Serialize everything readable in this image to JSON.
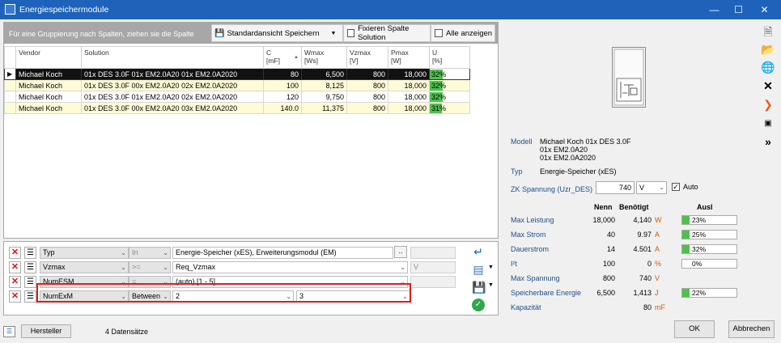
{
  "window": {
    "title": "Energiespeichermodule"
  },
  "groupbar": {
    "hint": "Für eine Gruppierung nach Spalten, ziehen sie die Spalte",
    "save_view": "Standardansicht Speichern",
    "fix_column": "Fixieren Spalte Solution",
    "show_all": "Alle anzeigen"
  },
  "grid": {
    "headers": [
      {
        "label": "Vendor",
        "unit": ""
      },
      {
        "label": "Solution",
        "unit": ""
      },
      {
        "label": "C",
        "unit": "[mF]"
      },
      {
        "label": "Wmax",
        "unit": "[Ws]"
      },
      {
        "label": "Vzmax",
        "unit": "[V]"
      },
      {
        "label": "Pmax",
        "unit": "[W]"
      },
      {
        "label": "U",
        "unit": "[%]"
      }
    ],
    "rows": [
      {
        "vendor": "Michael Koch",
        "solution": "01x DES 3.0F  01x EM2.0A20  01x EM2.0A2020",
        "c": "80",
        "wmax": "6,500",
        "vzmax": "800",
        "pmax": "18,000",
        "u": "32%",
        "u_value": 32
      },
      {
        "vendor": "Michael Koch",
        "solution": "01x DES 3.0F  00x EM2.0A20  02x EM2.0A2020",
        "c": "100",
        "wmax": "8,125",
        "vzmax": "800",
        "pmax": "18,000",
        "u": "32%",
        "u_value": 32
      },
      {
        "vendor": "Michael Koch",
        "solution": "01x DES 3.0F  01x EM2.0A20  02x EM2.0A2020",
        "c": "120",
        "wmax": "9,750",
        "vzmax": "800",
        "pmax": "18,000",
        "u": "32%",
        "u_value": 32
      },
      {
        "vendor": "Michael Koch",
        "solution": "01x DES 3.0F  00x EM2.0A20  03x EM2.0A2020",
        "c": "140.0",
        "wmax": "11,375",
        "vzmax": "800",
        "pmax": "18,000",
        "u": "31%",
        "u_value": 31
      }
    ]
  },
  "filters": [
    {
      "field": "Typ",
      "op": "In",
      "value": "Energie-Speicher (xES), Erweiterungsmodul (EM)",
      "value2": ""
    },
    {
      "field": "Vzmax",
      "op": ">=",
      "value": "Req_Vzmax",
      "value2": "V"
    },
    {
      "field": "NumESM",
      "op": "=",
      "value": "(auto)  [1 - 5]",
      "value2": ""
    },
    {
      "field": "NumExM",
      "op": "Between",
      "value": "2",
      "value2": "3"
    }
  ],
  "filter_browse": "..",
  "status": {
    "hersteller_btn": "Hersteller",
    "records": "4  Datensätze"
  },
  "details": {
    "modell_label": "Modell",
    "modell_lines": [
      "Michael Koch 01x DES 3.0F",
      "01x EM2.0A20",
      "01x EM2.0A2020"
    ],
    "typ_label": "Typ",
    "typ_value": "Energie-Speicher (xES)",
    "zk_label": "ZK Spannung (Uzr_DES)",
    "zk_value": "740",
    "zk_unit": "V",
    "auto_label": "Auto",
    "col_nenn": "Nenn",
    "col_benoetigt": "Benötigt",
    "col_ausl": "Ausl",
    "rows": [
      {
        "label": "Max Leistung",
        "nenn": "18,000",
        "ben": "4,140",
        "unit": "W",
        "ausl": "23%",
        "ausl_value": 23
      },
      {
        "label": "Max Strom",
        "nenn": "40",
        "ben": "9.97",
        "unit": "A",
        "ausl": "25%",
        "ausl_value": 25
      },
      {
        "label": "Dauerstrom",
        "nenn": "14",
        "ben": "4.501",
        "unit": "A",
        "ausl": "32%",
        "ausl_value": 32
      },
      {
        "label": "I²t",
        "nenn": "100",
        "ben": "0",
        "unit": "%",
        "ausl": "0%",
        "ausl_value": 0
      },
      {
        "label": "Max Spannung",
        "nenn": "800",
        "ben": "740",
        "unit": "V",
        "ausl": "",
        "ausl_value": null
      },
      {
        "label": "Speicherbare Energie",
        "nenn": "6,500",
        "ben": "1,413",
        "unit": "J",
        "ausl": "22%",
        "ausl_value": 22
      },
      {
        "label": "Kapazität",
        "nenn": "",
        "ben": "80",
        "unit": "mF",
        "ausl": "",
        "ausl_value": null
      }
    ]
  },
  "buttons": {
    "ok": "OK",
    "cancel": "Abbrechen"
  },
  "colors": {
    "titlebar": "#1e63b9",
    "highlight": "#e11b1b",
    "bar_green": "#4cc24c",
    "row_alt": "#fffbd6"
  }
}
